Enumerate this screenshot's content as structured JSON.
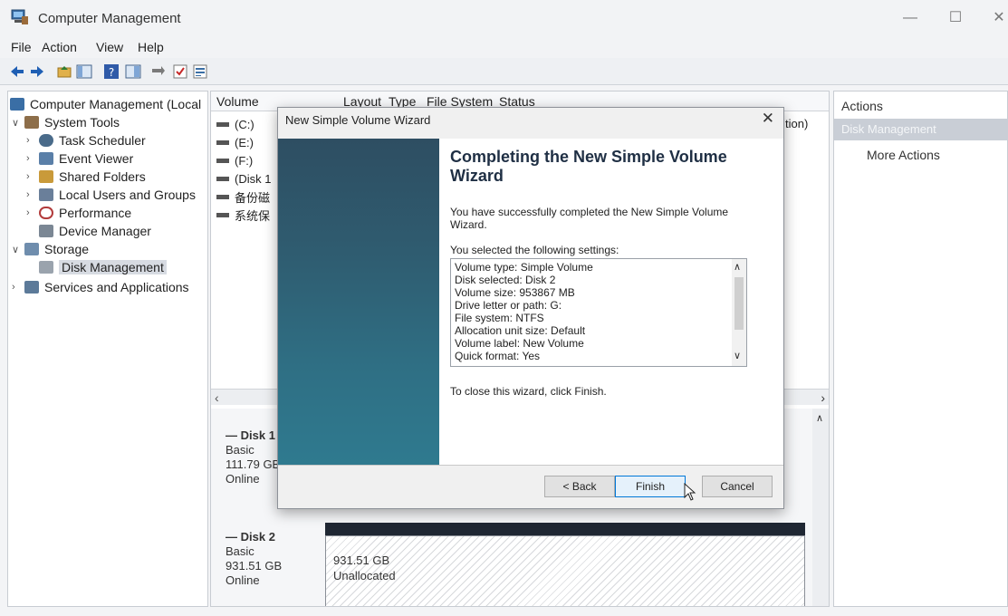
{
  "window": {
    "title": "Computer Management",
    "controls": {
      "minimize": "—",
      "maximize": "☐",
      "close": "✕"
    }
  },
  "menu": [
    "File",
    "Action",
    "View",
    "Help"
  ],
  "tree": {
    "root": "Computer Management (Local",
    "system_tools": "System Tools",
    "task_scheduler": "Task Scheduler",
    "event_viewer": "Event Viewer",
    "shared_folders": "Shared Folders",
    "local_users": "Local Users and Groups",
    "performance": "Performance",
    "device_manager": "Device Manager",
    "storage": "Storage",
    "disk_management": "Disk Management",
    "services": "Services and Applications"
  },
  "list": {
    "columns": [
      "Volume",
      "Layout",
      "Type",
      "File System",
      "Status"
    ],
    "status_suffix": "tion)",
    "volumes": [
      "(C:)",
      "(E:)",
      "(F:)",
      "(Disk 1",
      "备份磁",
      "系统保"
    ]
  },
  "disks": [
    {
      "name": "Disk 1",
      "type": "Basic",
      "size": "111.79 GB",
      "state": "Online"
    },
    {
      "name": "Disk 2",
      "type": "Basic",
      "size": "931.51 GB",
      "state": "Online",
      "partition_size": "931.51 GB",
      "partition_state": "Unallocated"
    }
  ],
  "actions": {
    "title": "Actions",
    "section": "Disk Management",
    "more": "More Actions"
  },
  "wizard": {
    "title": "New Simple Volume Wizard",
    "close": "✕",
    "heading": "Completing the New Simple Volume Wizard",
    "message": "You have successfully completed the New Simple Volume Wizard.",
    "settings_label": "You selected the following settings:",
    "settings": [
      "Volume type: Simple Volume",
      "Disk selected: Disk 2",
      "Volume size: 953867 MB",
      "Drive letter or path: G:",
      "File system: NTFS",
      "Allocation unit size: Default",
      "Volume label: New Volume",
      "Quick format: Yes"
    ],
    "finish_message": "To close this wizard, click Finish.",
    "buttons": {
      "back": "< Back",
      "finish": "Finish",
      "cancel": "Cancel"
    }
  },
  "colors": {
    "wizard_side": "#2f5c70",
    "selected_action": "#c9ced6",
    "finish_button_border": "#0078d7"
  }
}
